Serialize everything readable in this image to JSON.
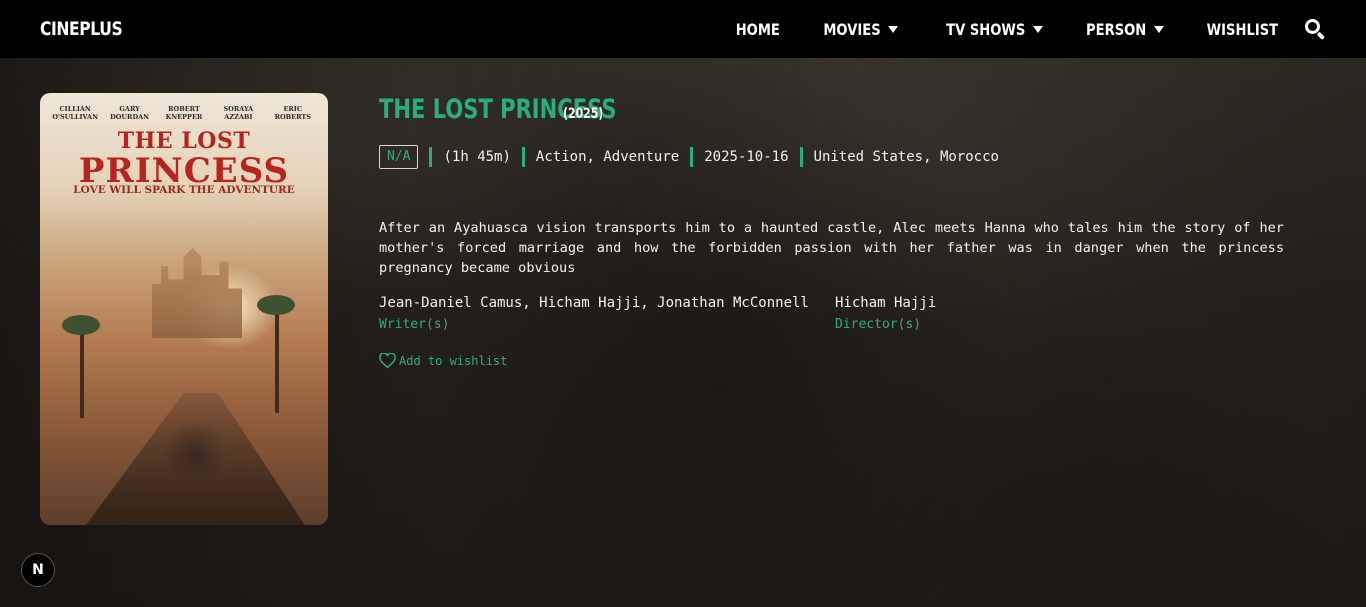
{
  "navbar": {
    "brand": "CINEPLUS",
    "items": [
      {
        "label": "HOME",
        "dropdown": false
      },
      {
        "label": "MOVIES",
        "dropdown": true
      },
      {
        "label": "TV SHOWS",
        "dropdown": true
      },
      {
        "label": "PERSON",
        "dropdown": true
      },
      {
        "label": "WISHLIST",
        "dropdown": false
      }
    ],
    "search_icon": "search-icon"
  },
  "movie": {
    "title": "THE LOST PRINCESS",
    "year": "(2025)",
    "rating": "N/A",
    "runtime": "(1h 45m)",
    "genres": "Action, Adventure",
    "release_date": "2025-10-16",
    "countries": "United States, Morocco",
    "overview": "After an Ayahuasca vision transports him to a haunted castle, Alec meets Hanna who tales him the story of her mother's forced marriage and how the forbidden passion with her father was in danger when the princess pregnancy became obvious",
    "writers": {
      "names": "Jean-Daniel Camus, Hicham Hajji, Jonathan McConnell",
      "role": "Writer(s)"
    },
    "director": {
      "names": "Hicham Hajji",
      "role": "Director(s)"
    },
    "wishlist_label": "Add to wishlist"
  },
  "poster": {
    "cast": [
      "CILLIAN O'SULLIVAN",
      "GARY DOURDAN",
      "ROBERT KNEPPER",
      "SORAYA AZZABI",
      "ERIC ROBERTS"
    ],
    "title_line1": "THE LOST",
    "title_line2": "PRINCESS",
    "tagline": "LOVE WILL SPARK THE ADVENTURE"
  },
  "dev_badge": "N",
  "colors": {
    "accent": "#27b07e",
    "navbar_bg": "#000000"
  }
}
